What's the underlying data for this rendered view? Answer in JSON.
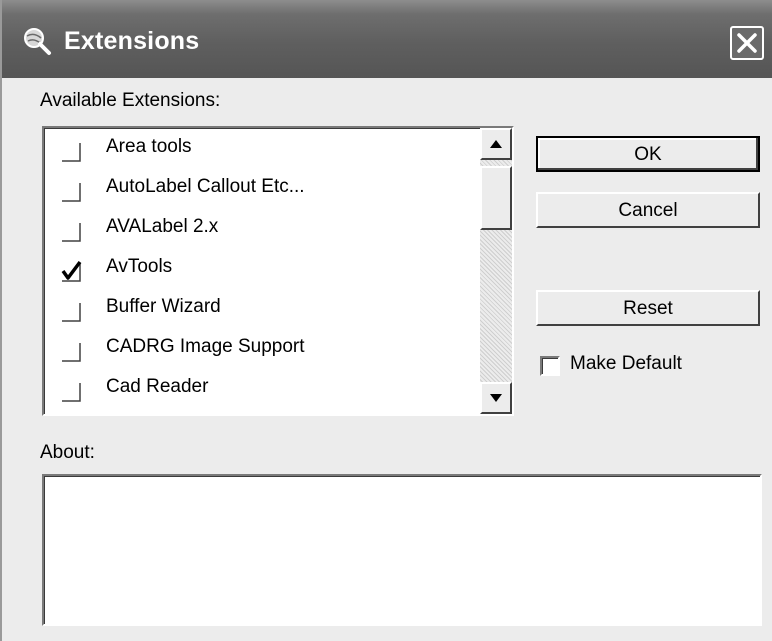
{
  "window": {
    "title": "Extensions",
    "icon": "magnifier-globe-icon",
    "close_icon": "close-icon"
  },
  "extensions_label": "Available Extensions:",
  "extensions": [
    {
      "label": "Area tools",
      "checked": false
    },
    {
      "label": "AutoLabel Callout Etc...",
      "checked": false
    },
    {
      "label": "AVALabel 2.x",
      "checked": false
    },
    {
      "label": "AvTools",
      "checked": true
    },
    {
      "label": "Buffer Wizard",
      "checked": false
    },
    {
      "label": "CADRG Image Support",
      "checked": false
    },
    {
      "label": "Cad Reader",
      "checked": false
    }
  ],
  "buttons": {
    "ok": "OK",
    "cancel": "Cancel",
    "reset": "Reset"
  },
  "make_default": {
    "label": "Make Default",
    "checked": false
  },
  "about_label": "About:",
  "about_text": ""
}
